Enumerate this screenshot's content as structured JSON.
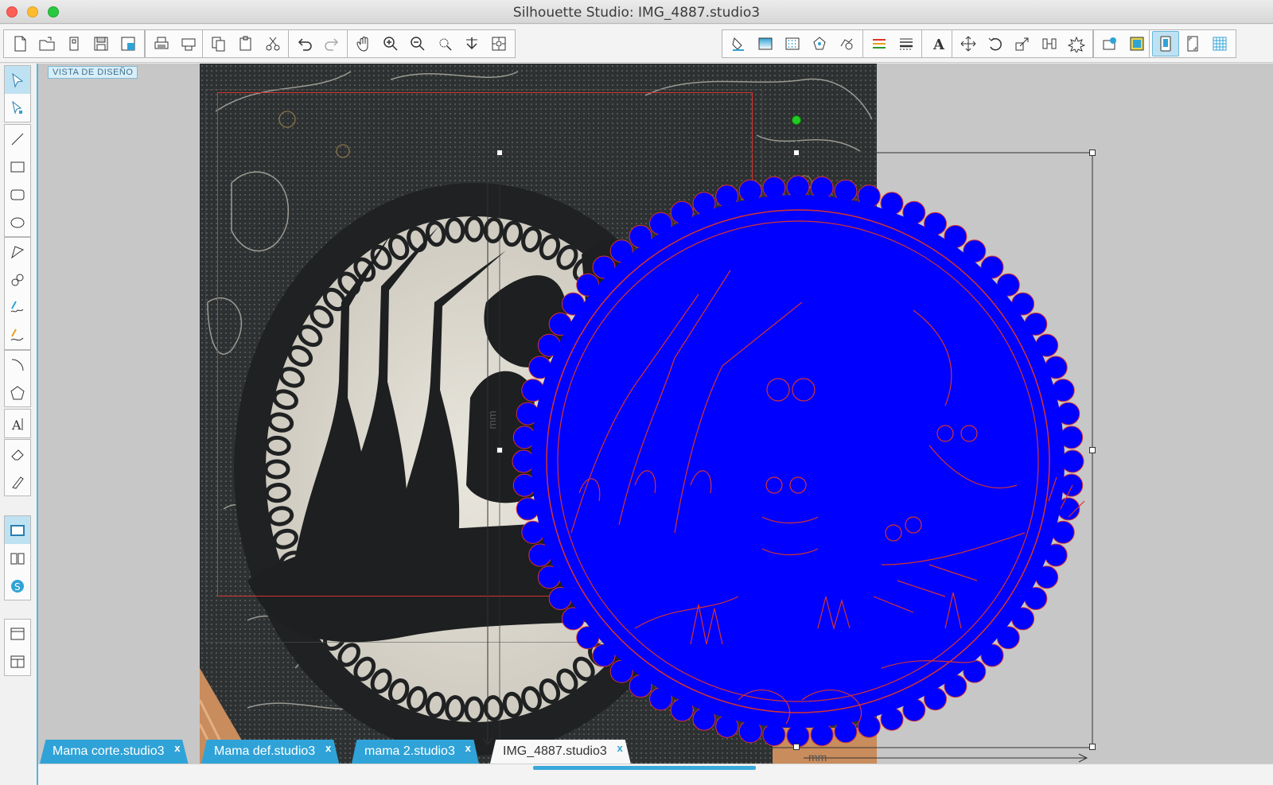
{
  "window": {
    "title": "Silhouette Studio: IMG_4887.studio3"
  },
  "canvas": {
    "view_label": "VISTA DE DISEÑO",
    "width_dim_label": "mm",
    "height_dim_label": "mm"
  },
  "toolbar": {
    "file_group": [
      "new-document-icon",
      "open-icon",
      "new-page-icon",
      "save-icon",
      "save-to-library-icon"
    ],
    "print_group": [
      "print-icon",
      "send-to-cutter-icon"
    ],
    "clipboard_group": [
      "copy-icon",
      "paste-icon",
      "cut-icon"
    ],
    "history_group": [
      "undo-icon",
      "redo-icon"
    ],
    "view_group": [
      "pan-icon",
      "zoom-in-icon",
      "zoom-out-icon",
      "zoom-selection-icon",
      "fit-page-icon",
      "zoom-fit-icon"
    ],
    "right_group": [
      "fill-color-icon",
      "gradient-icon",
      "fill-pattern-icon",
      "line-color-icon",
      "line-style-icon"
    ],
    "line_group": [
      "line-color-stripes-icon",
      "line-style-bars-icon"
    ],
    "text_group": [
      "text-style-icon"
    ],
    "transform_group": [
      "move-icon",
      "rotate-icon",
      "scale-icon",
      "align-icon",
      "replicate-icon"
    ],
    "library_group": [
      "library-icon",
      "store-icon"
    ],
    "panel_group": [
      "page-setup-icon",
      "registration-icon",
      "grid-icon"
    ]
  },
  "left_tools": {
    "select": [
      "select-tool-icon",
      "point-edit-tool-icon"
    ],
    "draw": [
      "line-tool-icon",
      "rectangle-tool-icon",
      "rounded-rectangle-tool-icon",
      "ellipse-tool-icon"
    ],
    "path": [
      "polygon-tool-icon",
      "curve-tool-icon",
      "freehand-tool-icon",
      "smooth-freehand-tool-icon"
    ],
    "shapes": [
      "arc-tool-icon",
      "regular-polygon-tool-icon"
    ],
    "text": [
      "text-tool-icon"
    ],
    "edit": [
      "eraser-tool-icon",
      "knife-tool-icon"
    ],
    "views": [
      "design-view-icon",
      "library-view-icon",
      "store-view-icon"
    ],
    "panels": [
      "single-panel-icon",
      "split-panel-icon"
    ]
  },
  "tabs": [
    {
      "label": "Mama corte.studio3",
      "close": "x",
      "active": false
    },
    {
      "label": "Mama def.studio3",
      "close": "x",
      "active": false
    },
    {
      "label": "mama 2.studio3",
      "close": "x",
      "active": false
    },
    {
      "label": "IMG_4887.studio3",
      "close": "x",
      "active": true
    }
  ],
  "colors": {
    "accent": "#2fa3d7",
    "trace_fill": "#0000ff",
    "cut_line": "#e0302c",
    "handle_green": "#22cc22",
    "canvas_bg": "#c7c7c7"
  }
}
